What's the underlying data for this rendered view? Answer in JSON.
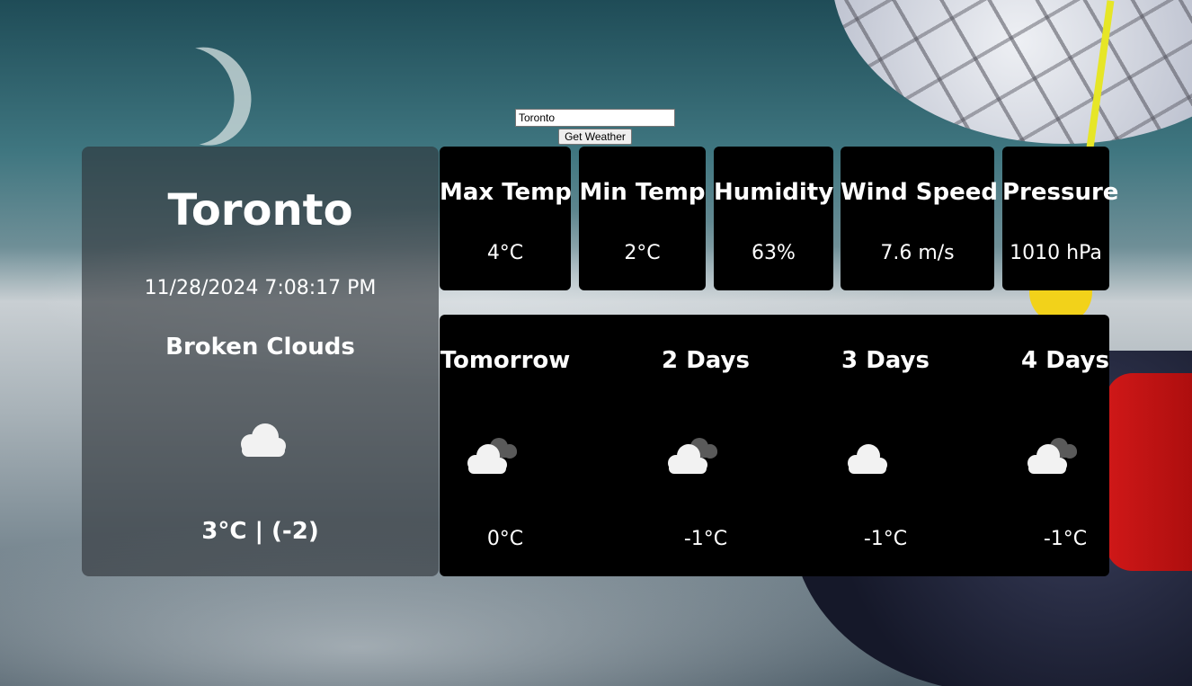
{
  "search": {
    "value": "Toronto",
    "button_label": "Get Weather"
  },
  "current": {
    "city": "Toronto",
    "datetime": "11/28/2024 7:08:17 PM",
    "description": "Broken Clouds",
    "icon": "cloud-icon",
    "temperature": "3°C | (-2)"
  },
  "stats": [
    {
      "label": "Max Temp",
      "value": "4°C"
    },
    {
      "label": "Min Temp",
      "value": "2°C"
    },
    {
      "label": "Humidity",
      "value": "63%"
    },
    {
      "label": "Wind Speed",
      "value": "7.6 m/s"
    },
    {
      "label": "Pressure",
      "value": "1010 hPa"
    }
  ],
  "forecast": [
    {
      "day": "Tomorrow",
      "icon": "broken-clouds-icon",
      "temp": "0°C"
    },
    {
      "day": "2 Days",
      "icon": "broken-clouds-icon",
      "temp": "-1°C"
    },
    {
      "day": "3 Days",
      "icon": "cloud-icon",
      "temp": "-1°C"
    },
    {
      "day": "4 Days",
      "icon": "broken-clouds-icon",
      "temp": "-1°C"
    }
  ]
}
